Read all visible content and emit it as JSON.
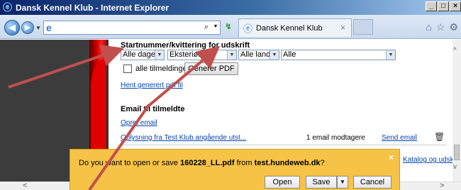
{
  "window": {
    "title": "Dansk Kennel Klub - Internet Explorer",
    "min_label": "_",
    "max_label": "□",
    "close_label": "×"
  },
  "navbar": {
    "address_value": "",
    "tab_title": "Dansk Kennel Klub",
    "tab_close": "×"
  },
  "page": {
    "startnummer": {
      "heading": "Startnummer/kvittering for udskrift",
      "select_days": "Alle dager",
      "select_type": "Eksteriør",
      "select_country": "Alle land",
      "select_all": "Alle",
      "checkbox_label": "alle tilmeldinger",
      "generate_button": "Generer PDF",
      "download_link": "Hent generert pdf fil"
    },
    "email": {
      "heading": "Email til tilmeldte",
      "create_link": "Opret email",
      "row_link": "Oplysning fra Test Klub angående utst...",
      "row_count": "1 email modtagere",
      "row_send": "Send email",
      "catalog_link": "Katalog og udskri"
    }
  },
  "download_bar": {
    "prefix": "Do you want to open or save ",
    "filename": "160228_LL.pdf",
    "middle": " from ",
    "host": "test.hundeweb.dk",
    "suffix": "?",
    "open_label": "Open",
    "save_label": "Save",
    "save_dd": "▼",
    "cancel_label": "Cancel",
    "close": "×"
  },
  "colors": {
    "arrow": "#c0504d",
    "notification": "#f6c347",
    "link": "#0645ad"
  }
}
